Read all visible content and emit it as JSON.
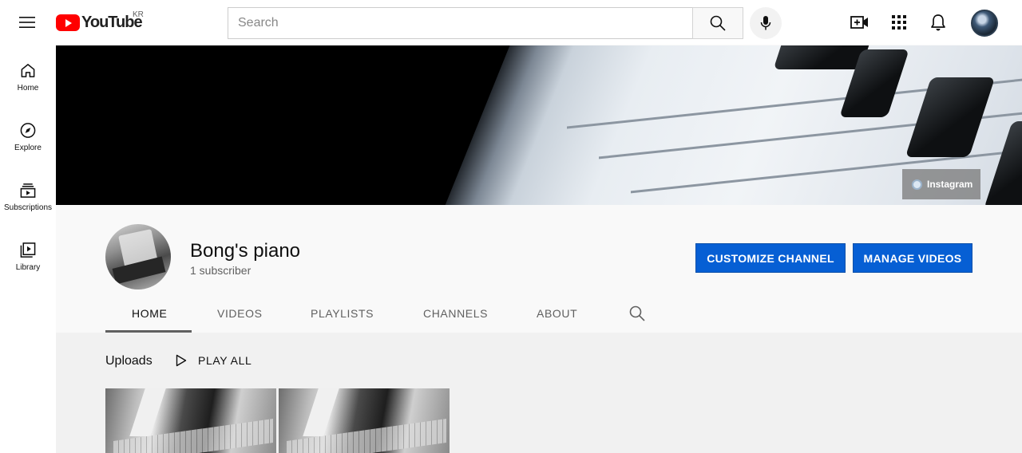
{
  "header": {
    "logo_text": "YouTube",
    "country": "KR",
    "search_placeholder": "Search"
  },
  "sidebar": {
    "items": [
      {
        "label": "Home",
        "icon": "home-icon"
      },
      {
        "label": "Explore",
        "icon": "compass-icon"
      },
      {
        "label": "Subscriptions",
        "icon": "subscriptions-icon"
      },
      {
        "label": "Library",
        "icon": "library-icon"
      }
    ]
  },
  "banner": {
    "link_label": "Instagram"
  },
  "channel": {
    "name": "Bong's piano",
    "subscribers": "1 subscriber",
    "customize_label": "CUSTOMIZE CHANNEL",
    "manage_label": "MANAGE VIDEOS"
  },
  "tabs": [
    {
      "label": "HOME",
      "active": true
    },
    {
      "label": "VIDEOS",
      "active": false
    },
    {
      "label": "PLAYLISTS",
      "active": false
    },
    {
      "label": "CHANNELS",
      "active": false
    },
    {
      "label": "ABOUT",
      "active": false
    }
  ],
  "uploads": {
    "title": "Uploads",
    "play_all_label": "PLAY ALL"
  },
  "colors": {
    "brand_red": "#ff0000",
    "accent_blue": "#065fd4"
  }
}
